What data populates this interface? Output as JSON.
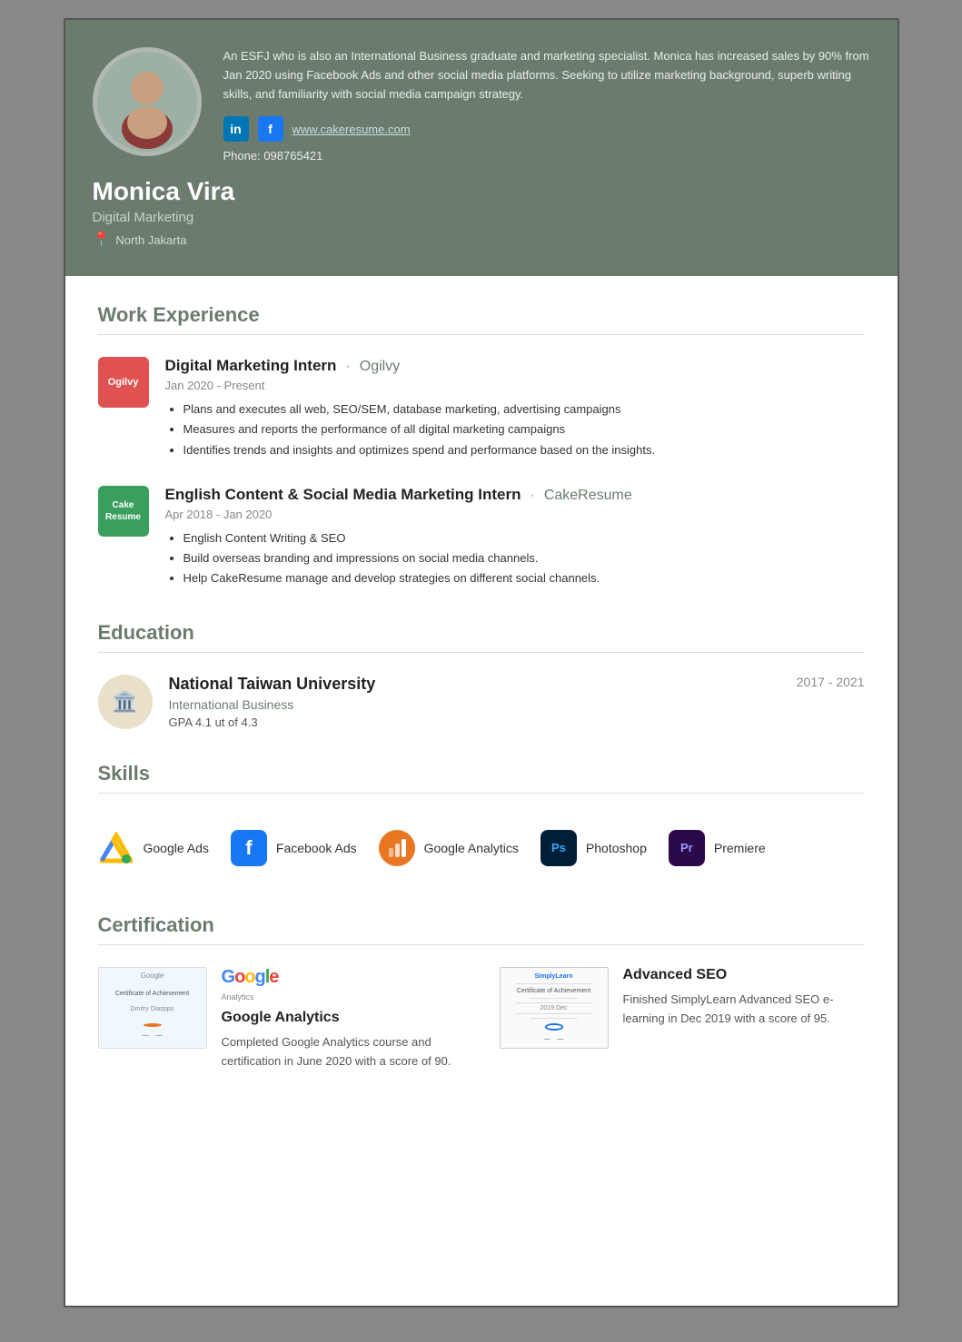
{
  "header": {
    "name": "Monica Vira",
    "title": "Digital Marketing",
    "location": "North Jakarta",
    "bio": "An ESFJ who is also an International Business graduate and marketing specialist. Monica has increased sales by 90% from Jan 2020 using Facebook Ads and other social media platforms. Seeking to utilize marketing background, superb writing skills, and familiarity with social media campaign strategy.",
    "website": "www.cakeresume.com",
    "phone": "Phone: 098765421"
  },
  "sections": {
    "work": "Work Experience",
    "education": "Education",
    "skills": "Skills",
    "certification": "Certification"
  },
  "jobs": [
    {
      "company": "Ogilvy",
      "logo_text": "Ogilvy",
      "logo_class": "logo-ogilvy",
      "title": "Digital Marketing Intern",
      "dates": "Jan 2020 - Present",
      "bullets": [
        "Plans and executes all web, SEO/SEM, database marketing, advertising campaigns",
        "Measures and reports the performance of all digital marketing campaigns",
        "Identifies trends and insights and optimizes spend and performance based on the insights."
      ]
    },
    {
      "company": "CakeResume",
      "logo_text": "Cake Resume",
      "logo_class": "logo-cake",
      "title": "English Content & Social Media Marketing Intern",
      "dates": "Apr 2018 - Jan 2020",
      "bullets": [
        "English Content Writing & SEO",
        "Build overseas branding and impressions on social media channels.",
        "Help CakeResume manage and develop strategies on different social channels."
      ]
    }
  ],
  "education": {
    "university": "National Taiwan University",
    "degree": "International Business",
    "gpa": "GPA 4.1 ut of 4.3",
    "years": "2017 - 2021"
  },
  "skills": [
    {
      "name": "Google Ads",
      "icon_class": "google-ads"
    },
    {
      "name": "Facebook Ads",
      "icon_class": "fb-ads"
    },
    {
      "name": "Google Analytics",
      "icon_class": "ga"
    },
    {
      "name": "Photoshop",
      "icon_class": "ps"
    },
    {
      "name": "Premiere",
      "icon_class": "pr"
    }
  ],
  "certifications": [
    {
      "name": "Google Analytics",
      "description": "Completed Google Analytics course and certification in June 2020 with a score of 90."
    },
    {
      "name": "Advanced SEO",
      "description": "Finished SimplyLearn Advanced SEO e-learning in Dec 2019 with a score of 95."
    }
  ]
}
